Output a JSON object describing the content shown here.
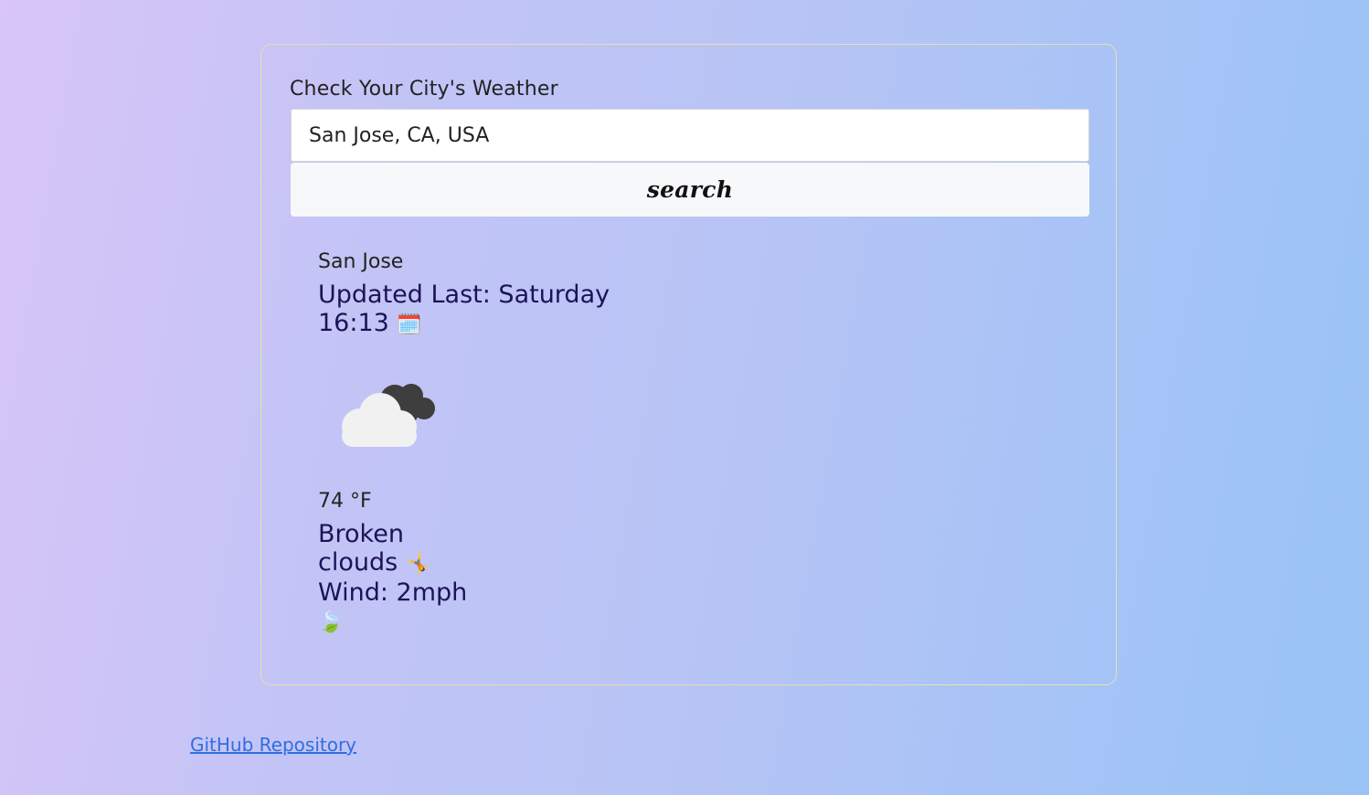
{
  "form": {
    "label": "Check Your City's Weather",
    "input_value": "San Jose, CA, USA",
    "search_label": "search"
  },
  "weather": {
    "city": "San Jose",
    "updated_label": "Updated Last: Saturday 16:13",
    "calendar_emoji": "🗓️",
    "icon": "broken-clouds-icon",
    "temperature": "74 °F",
    "description": "Broken clouds",
    "description_emoji": "🤸",
    "wind": "Wind: 2mph",
    "wind_emoji": "🍃"
  },
  "footer": {
    "repo_link": "GitHub Repository"
  }
}
